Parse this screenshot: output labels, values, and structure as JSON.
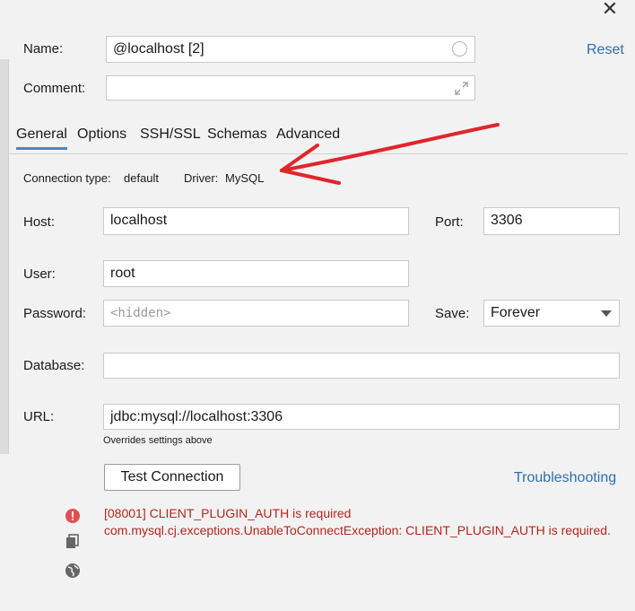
{
  "window": {
    "close_glyph": "✕"
  },
  "top": {
    "name_label": "Name:",
    "name_value": "@localhost [2]",
    "comment_label": "Comment:",
    "comment_value": "",
    "reset_link": "Reset"
  },
  "tabs": [
    {
      "label": "General",
      "active": true
    },
    {
      "label": "Options"
    },
    {
      "label": "SSH/SSL"
    },
    {
      "label": "Schemas"
    },
    {
      "label": "Advanced"
    }
  ],
  "connection": {
    "type_label": "Connection type:",
    "type_value": "default",
    "driver_label": "Driver:",
    "driver_value": "MySQL"
  },
  "form": {
    "host_label": "Host:",
    "host_value": "localhost",
    "port_label": "Port:",
    "port_value": "3306",
    "user_label": "User:",
    "user_value": "root",
    "password_label": "Password:",
    "password_placeholder": "<hidden>",
    "save_label": "Save:",
    "save_value": "Forever",
    "database_label": "Database:",
    "database_value": "",
    "url_label": "URL:",
    "url_value": "jdbc:mysql://localhost:3306",
    "url_hint": "Overrides settings above"
  },
  "actions": {
    "test_connection": "Test Connection",
    "troubleshooting": "Troubleshooting"
  },
  "error": {
    "line1": "[08001] CLIENT_PLUGIN_AUTH is required",
    "line2": "com.mysql.cj.exceptions.UnableToConnectException: CLIENT_PLUGIN_AUTH is required."
  },
  "colors": {
    "link": "#2e6fb0",
    "error": "#b3261e",
    "annotation_arrow": "#e0262b",
    "active_tab": "#4a86c8"
  },
  "icons": [
    "close-icon",
    "status-circle-icon",
    "expand-icon",
    "dropdown-arrow-icon",
    "error-icon",
    "copy-icon",
    "globe-icon"
  ]
}
